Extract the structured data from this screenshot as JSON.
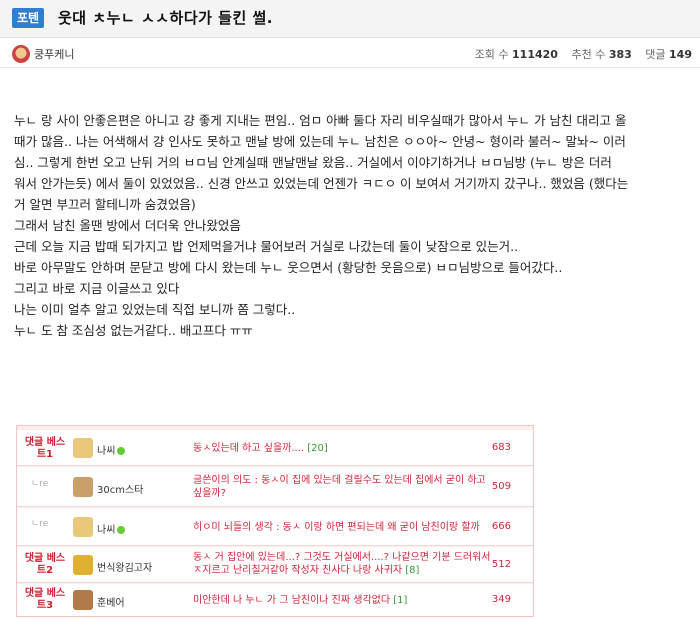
{
  "post": {
    "tag": "포텐",
    "title": "웃대 ㅊ누ㄴ ㅅㅅ하다가 들킨 썰.",
    "author": "쿵푸케니",
    "stats": {
      "views_label": "조회 수",
      "views": "111420",
      "recommend_label": "추천 수",
      "recommend": "383",
      "comments_label": "댓글",
      "comments": "149"
    }
  },
  "body_lines": [
    "누ㄴ 랑 사이 안좋은편은 아니고 걍 좋게 지내는 편임.. 엄ㅁ 아빠 둘다 자리 비우실때가 많아서 누ㄴ 가 남친 대리고 올",
    "때가 많음.. 나는 어색해서 걍 인사도 못하고 맨날 방에 있는데 누ㄴ 남친은 ㅇㅇ아~ 안녕~ 형이라 불러~ 말놔~ 이러",
    "심.. 그렇게 한번 오고 난뒤 거의 ㅂㅁ님 안계실때 맨날맨날 왔음.. 거실에서 이야기하거나 ㅂㅁ님방 (누ㄴ 방은 더러",
    "워서 안가는듯) 에서 둘이 있었었음.. 신경 안쓰고 있었는데 언젠가 ㅋㄷㅇ 이 보여서 거기까지 갔구나.. 했었음 (했다는",
    "거 알면 부끄러 할테니까 숨겼었음)",
    "그래서 남친 올땐 방에서 더더욱 안나왔었음",
    "근데 오늘 지금 밥때 되가지고 밥 언제먹을거냐 물어보러 거실로 나갔는데 둘이 낮잠으로 있는거..",
    "바로 아무말도 안하며 문닫고 방에 다시 왔는데 누ㄴ 웃으면서 (황당한 웃음으로) ㅂㅁ님방으로 들어갔다..",
    "그리고 바로 지금 이글쓰고 있다",
    "나는 이미 얼추 알고 있었는데 직접 보니까 쫌 그렇다..",
    "누ㄴ 도 참 조심성 없는거같다.. 배고프다 ㅠㅠ"
  ],
  "comments": [
    {
      "label": "댓글 베스트1",
      "is_sub": false,
      "name": "나씨",
      "online": true,
      "text": "동ㅅ있는데 하고 싶을까....",
      "count": "[20]",
      "votes": "683",
      "avatar_color": "#e9c77b"
    },
    {
      "label": "ㄴre",
      "is_sub": true,
      "name": "30cm스타",
      "online": false,
      "text": "글쓴이의 의도 : 동ㅅ이 집에 있는데 걸릴수도 있는데 집에서 굳이 하고 싶을까?",
      "count": "",
      "votes": "509",
      "avatar_color": "#c9a06a"
    },
    {
      "label": "ㄴre",
      "is_sub": true,
      "name": "나씨",
      "online": true,
      "text": "히ㅇ미 뇌들의 생각 : 동ㅅ 이랑 하면 편되는데 왜 굳이 남친이랑 할까",
      "count": "",
      "votes": "666",
      "avatar_color": "#e9c77b"
    },
    {
      "label": "댓글 베스트2",
      "is_sub": false,
      "name": "번식왕김고자",
      "online": false,
      "text": "동ㅅ 거 집안에 있는데...? 그것도 거실에서....? 나같으면 기분 드러워서 ㅈ지르고 난리칠거같아 작성자 친사다 나랑 사귀자",
      "count": "[8]",
      "votes": "512",
      "avatar_color": "#e0b030"
    },
    {
      "label": "댓글 베스트3",
      "is_sub": false,
      "name": "훈베어",
      "online": false,
      "text": "미안한데 나 누ㄴ 가 그 남친이나 진짜 생각없다",
      "count": "[1]",
      "votes": "349",
      "avatar_color": "#b07a4a"
    }
  ]
}
